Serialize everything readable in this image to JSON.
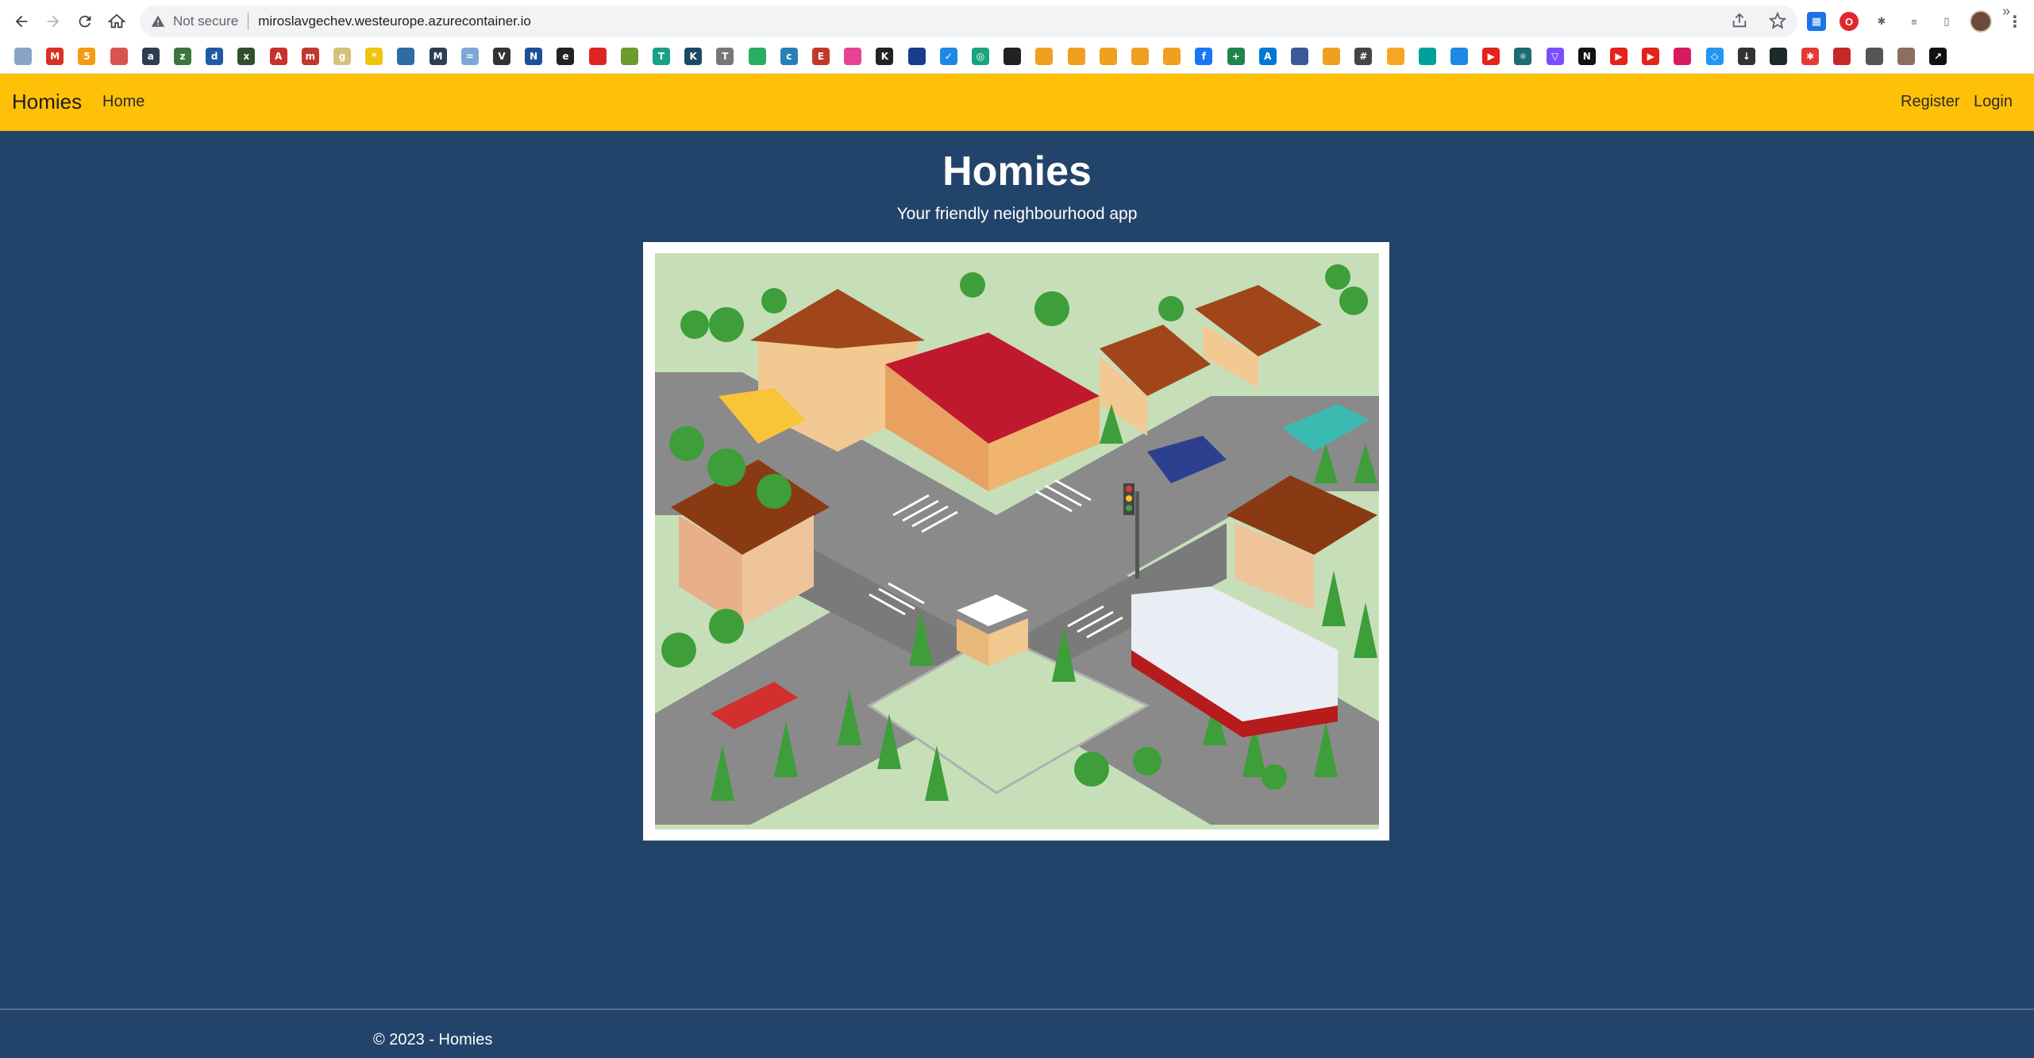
{
  "browser": {
    "security_label": "Not secure",
    "url": "miroslavgechev.westeurope.azurecontainer.io",
    "extensions": [
      {
        "icon": "calendar-icon",
        "color": "#1a73e8"
      },
      {
        "icon": "opera-icon",
        "color": "#e0282c"
      },
      {
        "icon": "puzzle-icon",
        "color": "#5f6368"
      },
      {
        "icon": "reading-list-icon",
        "color": "#5f6368"
      },
      {
        "icon": "side-panel-icon",
        "color": "#5f6368"
      }
    ],
    "bookmarks": [
      {
        "icon": "doc-icon",
        "color": "#8aa3c7",
        "glyph": ""
      },
      {
        "icon": "gmail-icon",
        "color": "#d93025",
        "glyph": "M"
      },
      {
        "icon": "orange-icon",
        "color": "#f39c12",
        "glyph": "5"
      },
      {
        "icon": "redbox-icon",
        "color": "#d9534f",
        "glyph": ""
      },
      {
        "icon": "a-icon",
        "color": "#2c3e50",
        "glyph": "a"
      },
      {
        "icon": "green-icon",
        "color": "#3c763d",
        "glyph": "z"
      },
      {
        "icon": "dir-icon",
        "color": "#1f5aa6",
        "glyph": "d"
      },
      {
        "icon": "x-icon",
        "color": "#2f4f2f",
        "glyph": "x"
      },
      {
        "icon": "red-a-icon",
        "color": "#c9302c",
        "glyph": "A"
      },
      {
        "icon": "m-icon",
        "color": "#c0392b",
        "glyph": "m"
      },
      {
        "icon": "g-icon",
        "color": "#d4c27c",
        "glyph": "g"
      },
      {
        "icon": "yellow-icon",
        "color": "#f1c40f",
        "glyph": "*"
      },
      {
        "icon": "blue-icon",
        "color": "#2e6da4",
        "glyph": ""
      },
      {
        "icon": "jm-icon",
        "color": "#2c3e50",
        "glyph": "M"
      },
      {
        "icon": "bars-icon",
        "color": "#7fa7d6",
        "glyph": "="
      },
      {
        "icon": "vb-icon",
        "color": "#333",
        "glyph": "V"
      },
      {
        "icon": "n-icon",
        "color": "#1f4f9a",
        "glyph": "N"
      },
      {
        "icon": "black-icon",
        "color": "#222",
        "glyph": "e"
      },
      {
        "icon": "red-square-icon",
        "color": "#e02424",
        "glyph": ""
      },
      {
        "icon": "green-yellow-icon",
        "color": "#6d9c2e",
        "glyph": ""
      },
      {
        "icon": "tc-icon",
        "color": "#16a085",
        "glyph": "T"
      },
      {
        "icon": "k-icon",
        "color": "#1b4965",
        "glyph": "K"
      },
      {
        "icon": "t-icon",
        "color": "#777",
        "glyph": "T"
      },
      {
        "icon": "green-circle-icon",
        "color": "#27ae60",
        "glyph": ""
      },
      {
        "icon": "blue-c-icon",
        "color": "#2980b9",
        "glyph": "c"
      },
      {
        "icon": "e-icon",
        "color": "#c0392b",
        "glyph": "E"
      },
      {
        "icon": "gradient-icon",
        "color": "#e84393",
        "glyph": ""
      },
      {
        "icon": "k2-icon",
        "color": "#222",
        "glyph": "K"
      },
      {
        "icon": "flag-icon",
        "color": "#1a3c8f",
        "glyph": ""
      },
      {
        "icon": "check-icon",
        "color": "#1e88e5",
        "glyph": "✓"
      },
      {
        "icon": "openai-icon",
        "color": "#19a37f",
        "glyph": "◎"
      },
      {
        "icon": "github-icon",
        "color": "#222",
        "glyph": ""
      },
      {
        "icon": "hex-1-icon",
        "color": "#f0a020",
        "glyph": ""
      },
      {
        "icon": "hex-2-icon",
        "color": "#f0a020",
        "glyph": ""
      },
      {
        "icon": "hex-3-icon",
        "color": "#f0a020",
        "glyph": ""
      },
      {
        "icon": "hex-4-icon",
        "color": "#f0a020",
        "glyph": ""
      },
      {
        "icon": "hex-5-icon",
        "color": "#f0a020",
        "glyph": ""
      },
      {
        "icon": "facebook-icon",
        "color": "#1877f2",
        "glyph": "f"
      },
      {
        "icon": "plus-green-icon",
        "color": "#1e8449",
        "glyph": "+"
      },
      {
        "icon": "azure-icon",
        "color": "#0078d4",
        "glyph": "A"
      },
      {
        "icon": "frame-icon",
        "color": "#3b5998",
        "glyph": ""
      },
      {
        "icon": "hex-6-icon",
        "color": "#f0a020",
        "glyph": ""
      },
      {
        "icon": "hash-icon",
        "color": "#444",
        "glyph": "#"
      },
      {
        "icon": "firebase-icon",
        "color": "#f5a623",
        "glyph": ""
      },
      {
        "icon": "diamond-icon",
        "color": "#00a19a",
        "glyph": ""
      },
      {
        "icon": "mui-icon",
        "color": "#1e88e5",
        "glyph": ""
      },
      {
        "icon": "youtube-1-icon",
        "color": "#e62117",
        "glyph": "▶"
      },
      {
        "icon": "react-icon",
        "color": "#1b6b73",
        "glyph": "⚛"
      },
      {
        "icon": "vite-icon",
        "color": "#7c4dff",
        "glyph": "▽"
      },
      {
        "icon": "next-icon",
        "color": "#111",
        "glyph": "N"
      },
      {
        "icon": "youtube-2-icon",
        "color": "#e62117",
        "glyph": "▶"
      },
      {
        "icon": "youtube-3-icon",
        "color": "#e62117",
        "glyph": "▶"
      },
      {
        "icon": "pink-icon",
        "color": "#d81b60",
        "glyph": ""
      },
      {
        "icon": "blue-diamond-icon",
        "color": "#2196f3",
        "glyph": "◇"
      },
      {
        "icon": "download-icon",
        "color": "#333",
        "glyph": "↓"
      },
      {
        "icon": "terminal-icon",
        "color": "#1b2b2b",
        "glyph": ""
      },
      {
        "icon": "star-red-icon",
        "color": "#e53935",
        "glyph": "✱"
      },
      {
        "icon": "red-swirl-icon",
        "color": "#c62828",
        "glyph": ""
      },
      {
        "icon": "pen-icon",
        "color": "#555",
        "glyph": ""
      },
      {
        "icon": "face-icon",
        "color": "#8d6e63",
        "glyph": ""
      },
      {
        "icon": "arrow-box-icon",
        "color": "#111",
        "glyph": "↗"
      }
    ]
  },
  "navbar": {
    "brand": "Homies",
    "home": "Home",
    "register": "Register",
    "login": "Login",
    "bg_color": "#ffc107"
  },
  "main": {
    "title": "Homies",
    "subtitle": "Your friendly neighbourhood app",
    "bg_color": "#23446a"
  },
  "footer": {
    "text": "© 2023 - Homies"
  }
}
